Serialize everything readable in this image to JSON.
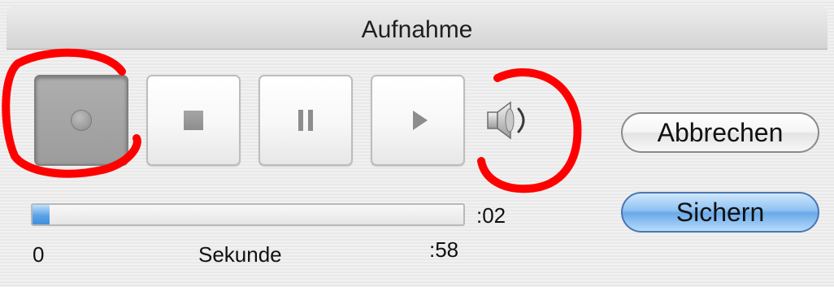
{
  "window": {
    "title": "Aufnahme"
  },
  "controls": {
    "record": {
      "icon": "record-icon",
      "state": "pressed"
    },
    "stop": {
      "icon": "stop-icon"
    },
    "pause": {
      "icon": "pause-icon"
    },
    "play": {
      "icon": "play-icon"
    },
    "volume": {
      "icon": "speaker-icon"
    }
  },
  "annotations": {
    "color": "#ff0000"
  },
  "progress": {
    "elapsed_label": ":02",
    "start_label": "0",
    "unit_label": "Sekunde",
    "end_label": ":58",
    "fraction": 0.04
  },
  "buttons": {
    "cancel_label": "Abbrechen",
    "save_label": "Sichern"
  },
  "colors": {
    "accent": "#5aa3e6",
    "annotation": "#ff0000"
  }
}
